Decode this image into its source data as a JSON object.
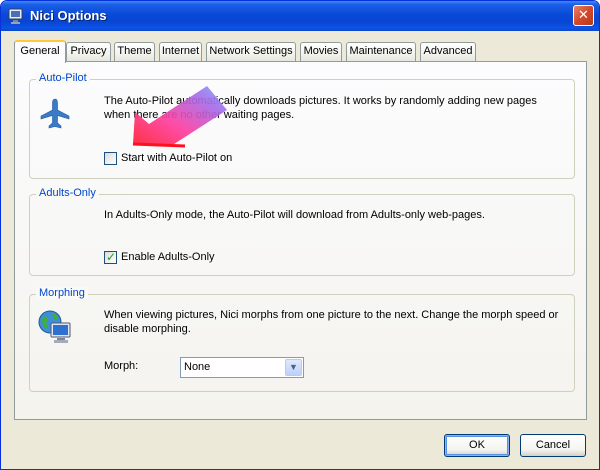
{
  "window": {
    "title": "Nici Options",
    "close_glyph": "✕"
  },
  "tabs": [
    {
      "label": "General",
      "active": true
    },
    {
      "label": "Privacy"
    },
    {
      "label": "Theme"
    },
    {
      "label": "Internet"
    },
    {
      "label": "Network Settings"
    },
    {
      "label": "Movies"
    },
    {
      "label": "Maintenance"
    },
    {
      "label": "Advanced"
    }
  ],
  "autopilot": {
    "title": "Auto-Pilot",
    "description": "The Auto-Pilot automatically downloads pictures. It works by randomly adding new pages when there are no other waiting pages.",
    "checkbox_label": "Start with Auto-Pilot on",
    "checked": false,
    "icon": "airplane-icon"
  },
  "adults": {
    "title": "Adults-Only",
    "description": "In Adults-Only mode, the Auto-Pilot will download from Adults-only web-pages.",
    "checkbox_label": "Enable Adults-Only",
    "checked": true
  },
  "morphing": {
    "title": "Morphing",
    "description": "When viewing pictures, Nici morphs from one picture to the next. Change the morph speed or disable morphing.",
    "morph_label": "Morph:",
    "morph_value": "None",
    "icon": "globe-monitor-icon"
  },
  "buttons": {
    "ok": "OK",
    "cancel": "Cancel"
  },
  "colors": {
    "titlebar": "#0a4ad8",
    "group_title": "#0046d5",
    "window_bg": "#ece9d8"
  }
}
